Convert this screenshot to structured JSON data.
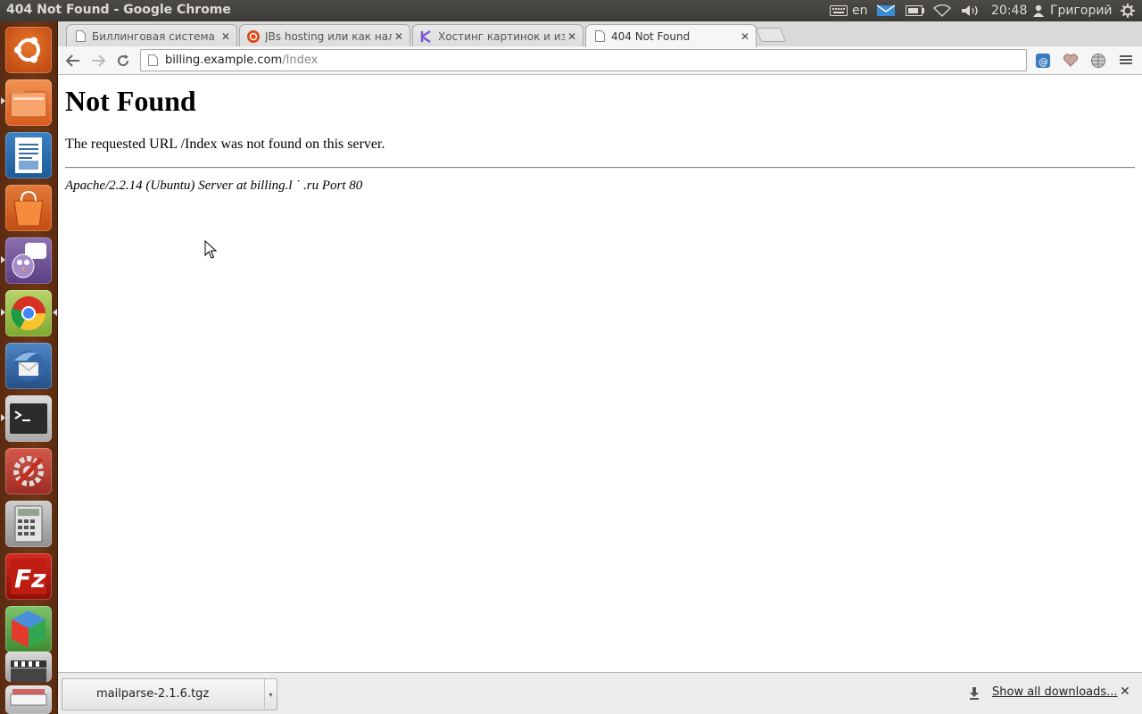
{
  "top_panel": {
    "window_title": "404 Not Found - Google Chrome",
    "keyboard_layout": "en",
    "clock": "20:48",
    "user_name": "Григорий",
    "icons": [
      "keyboard-icon",
      "mail-icon",
      "battery-icon",
      "wifi-icon",
      "volume-icon",
      "user-icon",
      "power-gear-icon"
    ]
  },
  "launcher": {
    "items": [
      {
        "name": "dash-home",
        "icon": "ubuntu-logo-icon"
      },
      {
        "name": "files",
        "icon": "folder-icon"
      },
      {
        "name": "libreoffice-writer",
        "icon": "document-icon"
      },
      {
        "name": "software-center",
        "icon": "shopping-bag-icon"
      },
      {
        "name": "pidgin",
        "icon": "chat-bird-icon"
      },
      {
        "name": "chrome",
        "icon": "chrome-icon"
      },
      {
        "name": "thunderbird",
        "icon": "mail-bird-icon"
      },
      {
        "name": "terminal",
        "icon": "terminal-icon"
      },
      {
        "name": "system-settings",
        "icon": "settings-wrench-icon"
      },
      {
        "name": "calculator",
        "icon": "calculator-icon"
      },
      {
        "name": "filezilla",
        "icon": "filezilla-icon"
      },
      {
        "name": "3d-app",
        "icon": "cube-icon"
      },
      {
        "name": "video-editor",
        "icon": "clapper-icon"
      },
      {
        "name": "scanner",
        "icon": "scanner-icon"
      }
    ]
  },
  "browser": {
    "tabs": [
      {
        "label": "Биллинговая система (Б",
        "favicon": "page-icon",
        "active": false
      },
      {
        "label": "JBs hosting или как нало",
        "favicon": "ubuntu-red-icon",
        "active": false
      },
      {
        "label": "Хостинг картинок и изоб",
        "favicon": "k-logo-icon",
        "active": false
      },
      {
        "label": "404 Not Found",
        "favicon": "page-icon",
        "active": true
      }
    ],
    "tab_close_glyph": "✕",
    "url_host": "billing.example.com",
    "url_path": "/Index"
  },
  "page": {
    "heading": "Not Found",
    "message": "The requested URL /Index was not found on this server.",
    "address": "Apache/2.2.14 (Ubuntu) Server at billing.l ˙      .ru Port 80"
  },
  "download_shelf": {
    "file_name": "mailparse-2.1.6.tgz",
    "show_all_label": "Show all downloads...",
    "close_glyph": "✕"
  },
  "colors": {
    "launcher_bg": "#6e3716",
    "panel_bg": "#3c3b37",
    "tab_strip": "#d9d9d9"
  }
}
